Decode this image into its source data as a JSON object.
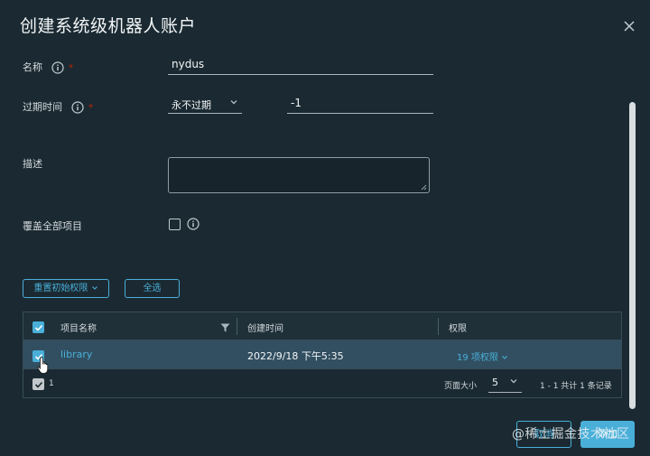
{
  "dialog": {
    "title": "创建系统级机器人账户"
  },
  "form": {
    "name": {
      "label": "名称",
      "required_mark": "*",
      "value": "nydus"
    },
    "expiration": {
      "label": "过期时间",
      "required_mark": "*",
      "select_value": "永不过期",
      "days_value": "-1"
    },
    "description": {
      "label": "描述",
      "value": ""
    },
    "cover_all": {
      "label": "覆盖全部项目",
      "checked": false
    }
  },
  "actions": {
    "reset_permissions": "重置初始权限",
    "select_all": "全选"
  },
  "table": {
    "columns": [
      "项目名称",
      "创建时间",
      "权限"
    ],
    "rows": [
      {
        "name": "library",
        "created": "2022/9/18 下午5:35",
        "permissions": "19 项权限",
        "selected": true
      }
    ],
    "footer": {
      "selected_count": "1",
      "page_size_label": "页面大小",
      "page_size": "5",
      "summary": "1 - 1 共计 1 条记录"
    }
  },
  "buttons": {
    "cancel": "取消",
    "confirm": "添加"
  },
  "watermark": "@稀土掘金技术社区",
  "colors": {
    "background": "#1b2a32",
    "accent": "#49afd9",
    "selected_row": "#324f61",
    "required": "#c92100"
  }
}
